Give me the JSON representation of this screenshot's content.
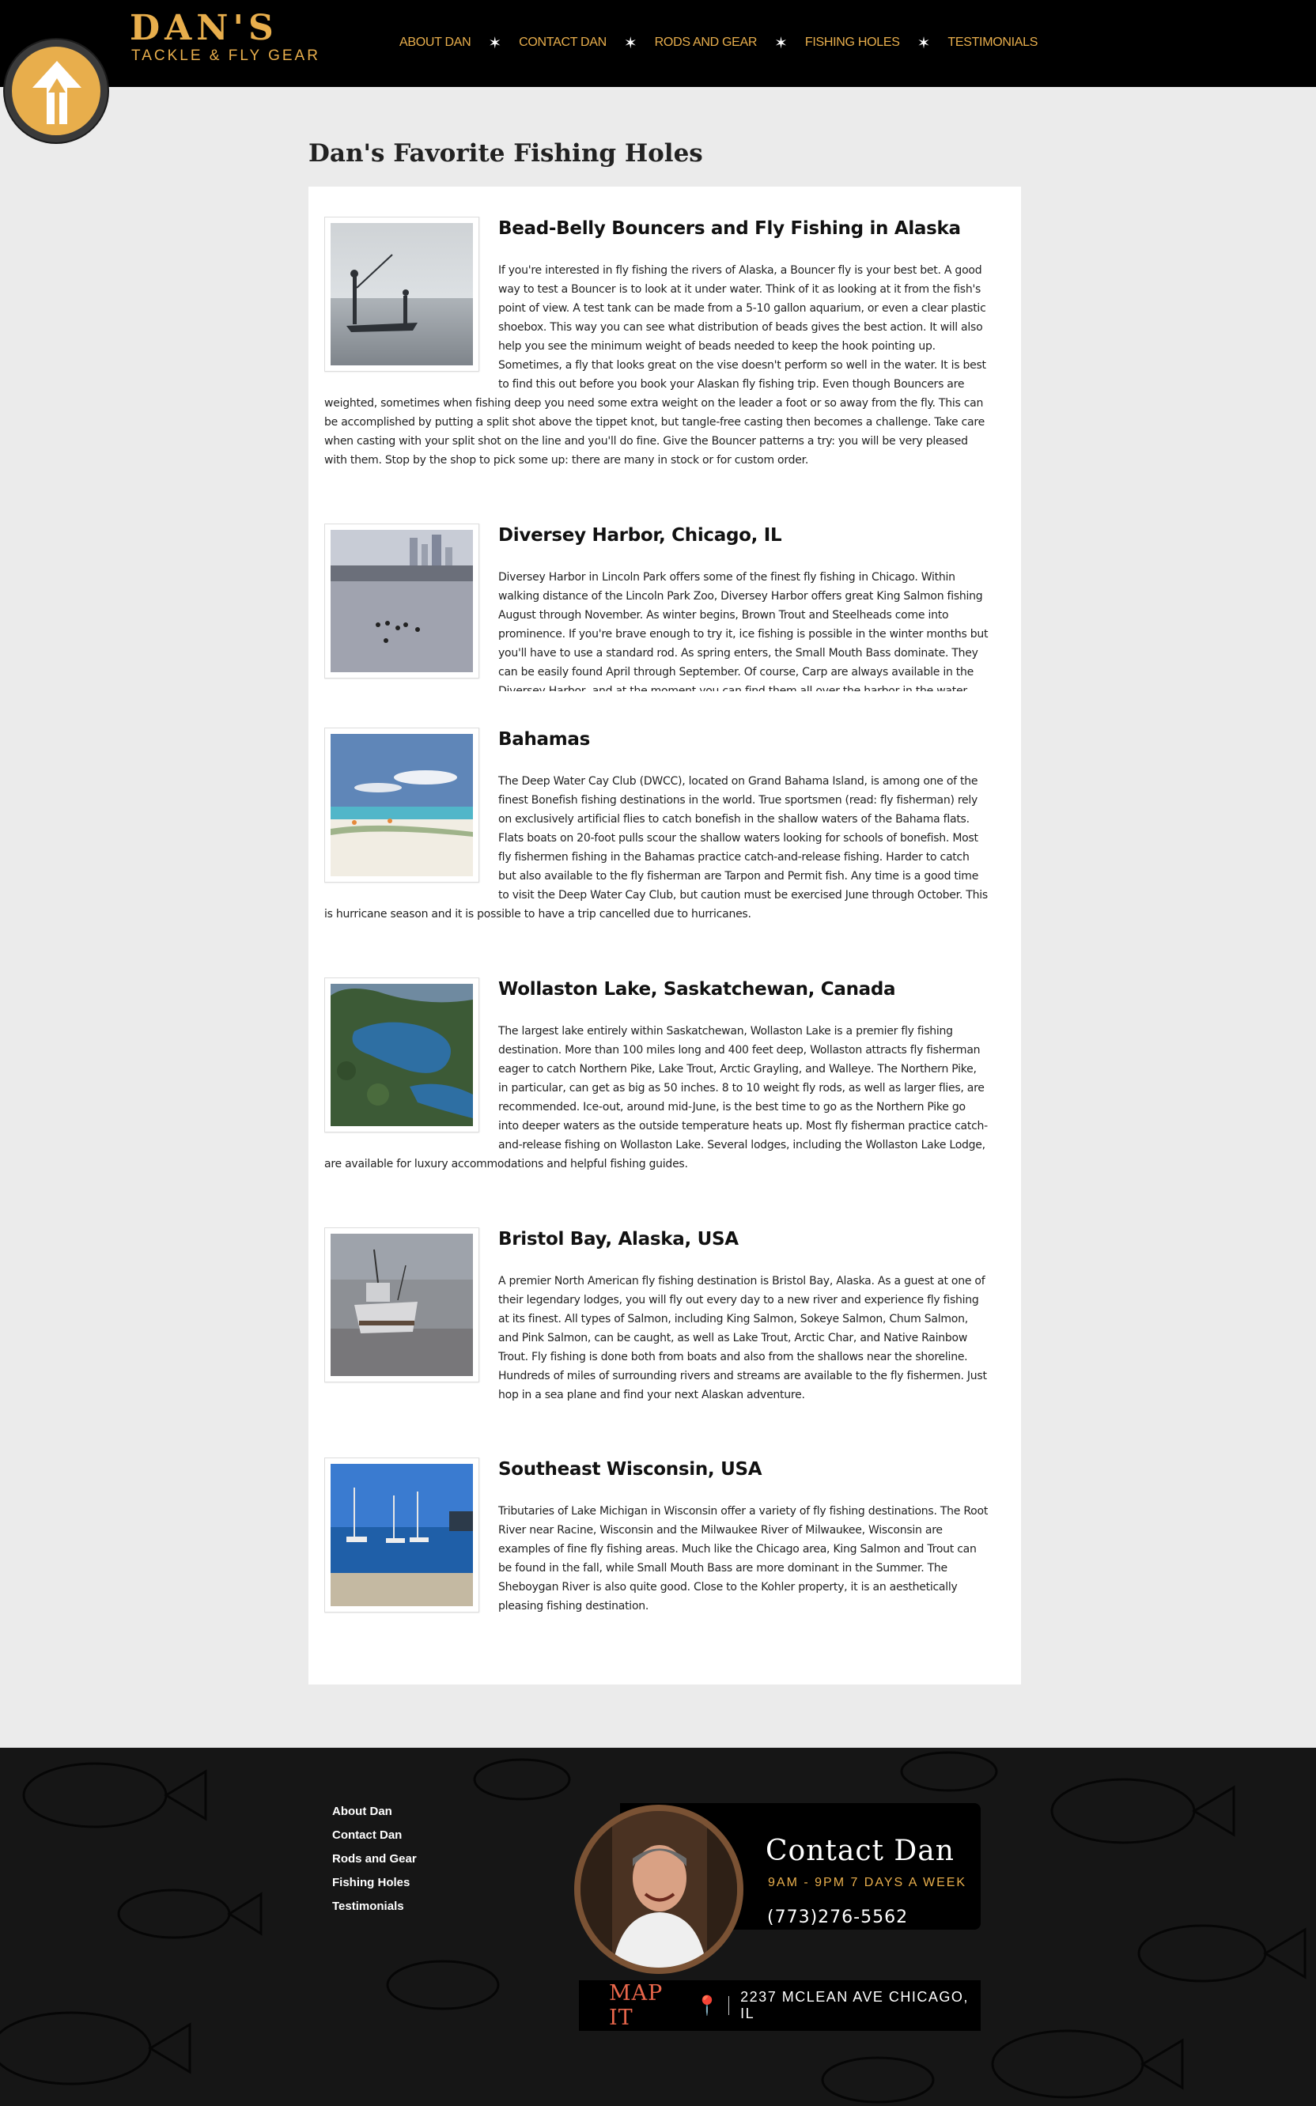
{
  "header": {
    "logo_title": "DAN'S",
    "logo_sub": "TACKLE & FLY GEAR",
    "nav": [
      {
        "label": "ABOUT DAN"
      },
      {
        "label": "CONTACT DAN"
      },
      {
        "label": "RODS AND GEAR"
      },
      {
        "label": "FISHING HOLES"
      },
      {
        "label": "TESTIMONIALS"
      }
    ],
    "separator": "✶"
  },
  "main": {
    "page_title": "Dan's Favorite Fishing Holes",
    "entries": [
      {
        "title": "Bead-Belly Bouncers and Fly Fishing in Alaska",
        "image": "boat-fishermen-photo",
        "text": "If you're interested in fly fishing the rivers of Alaska, a Bouncer fly is your best bet. A good way to test a Bouncer is to look at it under water. Think of it as looking at it from the fish's point of view. A test tank can be made from a 5-10 gallon aquarium, or even a clear plastic shoebox. This way you can see what distribution of beads gives the best action. It will also help you see the minimum weight of beads needed to keep the hook pointing up. Sometimes, a fly that looks great on the vise doesn't perform so well in the water. It is best to find this out before you book your Alaskan fly fishing trip. Even though Bouncers are weighted, sometimes when fishing deep you need some extra weight on the leader a foot or so away from the fly. This can be accomplished by putting a split shot above the tippet knot, but tangle-free casting then becomes a challenge. Take care when casting with your split shot on the line and you'll do fine. Give the Bouncer patterns a try: you will be very pleased with them. Stop by the shop to pick some up: there are many in stock or for custom order."
      },
      {
        "title": "Diversey Harbor, Chicago, IL",
        "image": "harbor-ducks-photo",
        "text": "Diversey Harbor in Lincoln Park offers some of the finest fly fishing in Chicago. Within walking distance of the Lincoln Park Zoo, Diversey Harbor offers great King Salmon fishing August through November. As winter begins, Brown Trout and Steelheads come into prominence. If you're brave enough to try it, ice fishing is possible in the winter months but you'll have to use a standard rod. As spring enters, the Small Mouth Bass dominate. They can be easily found April through September. Of course, Carp are always available in the Diversey Harbor, and at the moment you can find them all over the harbor in the water."
      },
      {
        "title": "Bahamas",
        "image": "beach-photo",
        "text": "The Deep Water Cay Club (DWCC), located on Grand Bahama Island, is among one of the finest Bonefish fishing destinations in the world. True sportsmen (read: fly fisherman) rely on exclusively artificial flies to catch bonefish in the shallow waters of the Bahama flats. Flats boats on 20-foot pulls scour the shallow waters looking for schools of bonefish. Most fly fishermen fishing in the Bahamas practice catch-and-release fishing. Harder to catch but also available to the fly fisherman are Tarpon and Permit fish. Any time is a good time to visit the Deep Water Cay Club, but caution must be exercised June through October. This is hurricane season and it is possible to have a trip cancelled due to hurricanes."
      },
      {
        "title": "Wollaston Lake, Saskatchewan, Canada",
        "image": "lake-aerial-photo",
        "text": "The largest lake entirely within Saskatchewan, Wollaston Lake is a premier fly fishing destination. More than 100 miles long and 400 feet deep, Wollaston attracts fly fisherman eager to catch Northern Pike, Lake Trout, Arctic Grayling, and Walleye. The Northern Pike, in particular, can get as big as 50 inches. 8 to 10 weight fly rods, as well as larger flies, are recommended. Ice-out, around mid-June, is the best time to go as the Northern Pike go into deeper waters as the outside temperature heats up. Most fly fisherman practice catch-and-release fishing on Wollaston Lake. Several lodges, including the Wollaston Lake Lodge, are available for luxury accommodations and helpful fishing guides."
      },
      {
        "title": "Bristol Bay, Alaska, USA",
        "image": "fishing-boat-photo",
        "text": "A premier North American fly fishing destination is Bristol Bay, Alaska. As a guest at one of their legendary lodges, you will fly out every day to a new river and experience fly fishing at its finest. All types of Salmon, including King Salmon, Sokeye Salmon, Chum Salmon, and Pink Salmon, can be caught, as well as Lake Trout, Arctic Char, and Native Rainbow Trout. Fly fishing is done both from boats and also from the shallows near the shoreline. Hundreds of miles of surrounding rivers and streams are available to the fly fishermen. Just hop in a sea plane and find your next Alaskan adventure."
      },
      {
        "title": "Southeast Wisconsin, USA",
        "image": "marina-photo",
        "text": "Tributaries of Lake Michigan in Wisconsin offer a variety of fly fishing destinations. The Root River near Racine, Wisconsin and the Milwaukee River of Milwaukee, Wisconsin are examples of fine fly fishing areas. Much like the Chicago area, King Salmon and Trout can be found in the fall, while Small Mouth Bass are more dominant in the Summer. The Sheboygan River is also quite good. Close to the Kohler property, it is an aesthetically pleasing fishing destination."
      }
    ]
  },
  "footer": {
    "links": [
      {
        "label": "About Dan"
      },
      {
        "label": "Contact Dan"
      },
      {
        "label": "Rods and Gear"
      },
      {
        "label": "Fishing Holes"
      },
      {
        "label": "Testimonials"
      }
    ],
    "contact_title": "Contact Dan",
    "contact_hours": "9AM - 9PM 7 DAYS A WEEK",
    "contact_phone": "(773)276-5562",
    "map_label": "MAP IT",
    "map_pin_icon": "map-pin-icon",
    "address": "2237 MCLEAN AVE CHICAGO, IL"
  },
  "colors": {
    "accent": "#e8ae4c",
    "header_bg": "#000000",
    "page_bg": "#ebebeb",
    "map_red": "#e8664b"
  }
}
